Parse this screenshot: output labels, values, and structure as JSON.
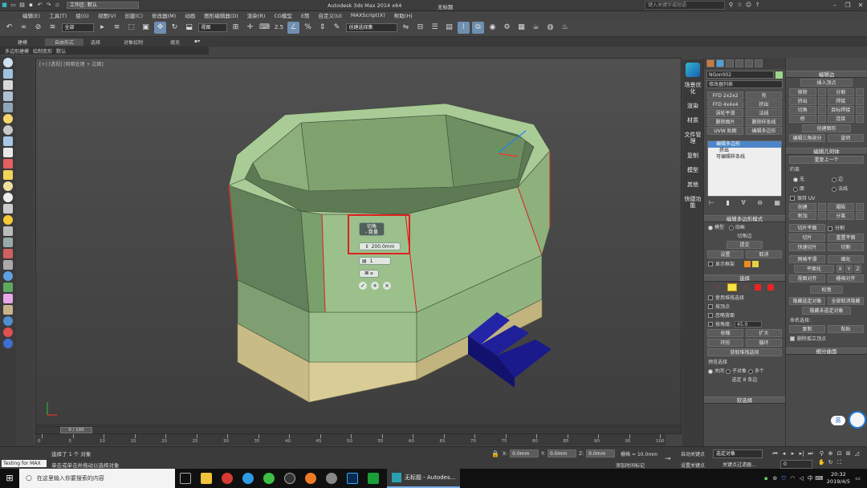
{
  "titlebar": {
    "app_title": "Autodesk 3ds Max  2014 x64",
    "doc_title": "无标题",
    "workspace": "工作区: 默认",
    "search_placeholder": "键入关键字或短语",
    "menu": [
      "编辑(E)",
      "工具(T)",
      "组(G)",
      "视图(V)",
      "创建(C)",
      "修改器(M)",
      "动画",
      "图形编辑器(D)",
      "渲染(R)",
      "CG模型",
      "E筒",
      "自定义(U)",
      "MAXScript(X)",
      "帮助(H)"
    ]
  },
  "toolbar": {
    "selection_filter": "全部",
    "ref_coord": "视图",
    "snap_value": "2.5",
    "named_selection": "创建选择集"
  },
  "ribbon": {
    "tabs": [
      "建模",
      "自由形式",
      "选择",
      "对象绘制",
      "填充"
    ],
    "sub": [
      "多边形建模",
      "绘制变形",
      "默认"
    ]
  },
  "viewport": {
    "label": "[+] [透视] [明暗处理 + 边面]"
  },
  "caddy": {
    "title": "切角",
    "subtitle": "- 数量",
    "amount": "200.0mm",
    "segments": "1"
  },
  "tabs": [
    "场景优化",
    "渲染",
    "材质",
    "文件管理",
    "复制",
    "模型",
    "其他",
    "快捷功能"
  ],
  "cmd": {
    "object_name": "NGon002",
    "modifier_list": "修改器列表",
    "buttons": [
      "FFD 2x2x2",
      "壳",
      "FFD 4x4x4",
      "挤出",
      "涡轮平滑",
      "法线",
      "删除面片",
      "删除样条线",
      "UVW 贴图",
      "编辑多边形"
    ],
    "stack": [
      "编辑多边形",
      "挤出",
      "可编辑样条线"
    ],
    "edit_mode_hdr": "编辑多边形模式",
    "mode_model": "模型",
    "mode_anim": "动画",
    "bevel": "切角边",
    "commit": "提交",
    "settings": "设置",
    "cancel": "取消",
    "show_cage": "显示框架",
    "sel_hdr": "选择",
    "sel_opts": [
      "使用堆栈选择",
      "按顶点",
      "忽略背面"
    ],
    "angle_label": "按角度:",
    "angle_value": "45.0",
    "shrink": "收缩",
    "grow": "扩大",
    "ring": "环形",
    "loop": "循环",
    "get_stack": "获取堆栈选择",
    "preview_label": "预览选择",
    "preview_off": "关闭",
    "preview_sub": "子对象",
    "preview_multi": "多个",
    "status": "选定 8 条边",
    "soft_sel": "软选择"
  },
  "edit": {
    "edit_edges_hdr": "编辑边",
    "insert_vertex": "插入顶点",
    "grid1": [
      "移除",
      "分割",
      "挤出",
      "焊接",
      "切角",
      "目标焊接",
      "桥",
      "连接"
    ],
    "create_shape": "创建图形",
    "edit_tri": "编辑三角剖分",
    "spin": "旋转",
    "geo_hdr": "编辑几何体",
    "repeat_last": "重复上一个",
    "constraint_label": "约束",
    "c_none": "无",
    "c_edge": "边",
    "c_face": "面",
    "c_normal": "法线",
    "keep_uv": "保持 UV",
    "grid2": [
      "创建",
      "塌陷",
      "附加",
      "分离"
    ],
    "slice_plane": "切片平面",
    "split": "分割",
    "slice": "切片",
    "reset_plane": "重置平面",
    "quickslice": "快速切片",
    "cut": "切割",
    "meshsmooth": "网格平滑",
    "tessellate": "细化",
    "make_planar": "平面化",
    "axes": [
      "X",
      "Y",
      "Z"
    ],
    "view_align": "视图对齐",
    "grid_align": "栅格对齐",
    "relax": "松弛",
    "hide_sel": "隐藏选定对象",
    "unhide_all": "全部取消隐藏",
    "hide_unsel": "隐藏未选定对象",
    "named_sel": "命名选择:",
    "copy": "复制",
    "paste": "粘贴",
    "del_iso": "删除孤立顶点",
    "subdiv_hdr": "细分曲面"
  },
  "timeline": {
    "frame": "0 / 100",
    "ticks": [
      "0",
      "5",
      "10",
      "15",
      "20",
      "25",
      "30",
      "35",
      "40",
      "45",
      "50",
      "55",
      "60",
      "65",
      "70",
      "75",
      "80",
      "85",
      "90",
      "95",
      "100"
    ]
  },
  "status": {
    "maxscript": "Testing for MAX",
    "line1": "选择了 1 个 对象",
    "line2": "单击或单击并拖动以选择对象",
    "x": "0.0mm",
    "y": "0.0mm",
    "z": "0.0mm",
    "grid": "栅格 = 10.0mm",
    "add_time_tag": "添加时间标记",
    "auto_key": "自动关键点",
    "set_key": "设置关键点",
    "selected_object": "选定对象",
    "key_filter": "关键点过滤器...",
    "frame": "0"
  },
  "taskbar": {
    "search": "在这里输入你要搜索的内容",
    "active_task": "无标题 - Autodes...",
    "time": "20:32",
    "date": "2019/4/5",
    "ime": "英"
  },
  "colors": {
    "mesh": "#9bbf8a",
    "mesh_dark": "#6f8f62",
    "base": "#d2c58f",
    "stairs": "#1d1d8f",
    "accent": "#e02020"
  }
}
